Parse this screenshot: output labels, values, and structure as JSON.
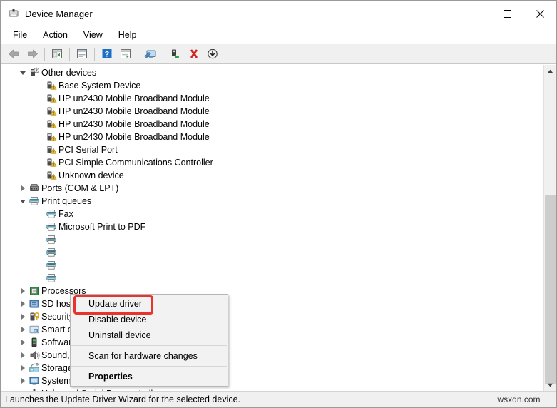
{
  "window": {
    "title": "Device Manager",
    "icon": "device-manager-icon",
    "controls": {
      "minimize": "—",
      "maximize": "☐",
      "close": "✕"
    }
  },
  "menubar": {
    "items": [
      "File",
      "Action",
      "View",
      "Help"
    ]
  },
  "toolbar": {
    "buttons": [
      {
        "name": "back-button",
        "glyph": "back-arrow-icon"
      },
      {
        "name": "forward-button",
        "glyph": "forward-arrow-icon"
      },
      {
        "sep": true
      },
      {
        "name": "show-hide-console-tree-button",
        "glyph": "console-tree-icon"
      },
      {
        "sep": true
      },
      {
        "name": "properties-button",
        "glyph": "properties-window-icon"
      },
      {
        "sep": true
      },
      {
        "name": "help-button",
        "glyph": "help-question-icon"
      },
      {
        "name": "view-button",
        "glyph": "view-list-icon"
      },
      {
        "sep": true
      },
      {
        "name": "scan-for-hardware-changes-button",
        "glyph": "scan-monitor-icon"
      },
      {
        "sep": true
      },
      {
        "name": "update-driver-button",
        "glyph": "update-driver-icon"
      },
      {
        "name": "uninstall-device-button",
        "glyph": "red-x-icon"
      },
      {
        "name": "disable-device-button",
        "glyph": "down-arrow-circle-icon"
      }
    ]
  },
  "tree": {
    "rows": [
      {
        "depth": 0,
        "twisty": "down",
        "icon": "unknown-device-icon",
        "label": "Other devices"
      },
      {
        "depth": 1,
        "twisty": "none",
        "icon": "warning-device-icon",
        "label": "Base System Device"
      },
      {
        "depth": 1,
        "twisty": "none",
        "icon": "warning-device-icon",
        "label": "HP un2430 Mobile Broadband Module"
      },
      {
        "depth": 1,
        "twisty": "none",
        "icon": "warning-device-icon",
        "label": "HP un2430 Mobile Broadband Module"
      },
      {
        "depth": 1,
        "twisty": "none",
        "icon": "warning-device-icon",
        "label": "HP un2430 Mobile Broadband Module"
      },
      {
        "depth": 1,
        "twisty": "none",
        "icon": "warning-device-icon",
        "label": "HP un2430 Mobile Broadband Module"
      },
      {
        "depth": 1,
        "twisty": "none",
        "icon": "warning-device-icon",
        "label": "PCI Serial Port"
      },
      {
        "depth": 1,
        "twisty": "none",
        "icon": "warning-device-icon",
        "label": "PCI Simple Communications Controller"
      },
      {
        "depth": 1,
        "twisty": "none",
        "icon": "warning-device-icon",
        "label": "Unknown device"
      },
      {
        "depth": 0,
        "twisty": "right",
        "icon": "ports-icon",
        "label": "Ports (COM & LPT)"
      },
      {
        "depth": 0,
        "twisty": "down",
        "icon": "printer-icon",
        "label": "Print queues"
      },
      {
        "depth": 1,
        "twisty": "none",
        "icon": "printer-icon",
        "label": "Fax"
      },
      {
        "depth": 1,
        "twisty": "none",
        "icon": "printer-icon",
        "label": "Microsoft Print to PDF"
      },
      {
        "depth": 1,
        "twisty": "none",
        "icon": "printer-icon",
        "label": "",
        "selected": true
      },
      {
        "depth": 1,
        "twisty": "none",
        "icon": "printer-icon",
        "label": ""
      },
      {
        "depth": 1,
        "twisty": "none",
        "icon": "printer-icon",
        "label": ""
      },
      {
        "depth": 1,
        "twisty": "none",
        "icon": "printer-icon",
        "label": ""
      },
      {
        "depth": 0,
        "twisty": "right",
        "icon": "processor-icon",
        "label": "Processors"
      },
      {
        "depth": 0,
        "twisty": "right",
        "icon": "sd-host-adapter-icon",
        "label": "SD host adapters"
      },
      {
        "depth": 0,
        "twisty": "right",
        "icon": "security-device-icon",
        "label": "Security devices"
      },
      {
        "depth": 0,
        "twisty": "right",
        "icon": "smart-card-reader-icon",
        "label": "Smart card readers"
      },
      {
        "depth": 0,
        "twisty": "right",
        "icon": "software-device-icon",
        "label": "Software devices"
      },
      {
        "depth": 0,
        "twisty": "right",
        "icon": "sound-icon",
        "label": "Sound, video and game controllers"
      },
      {
        "depth": 0,
        "twisty": "right",
        "icon": "storage-controller-icon",
        "label": "Storage controllers"
      },
      {
        "depth": 0,
        "twisty": "right",
        "icon": "system-device-icon",
        "label": "System devices"
      },
      {
        "depth": 0,
        "twisty": "right",
        "icon": "usb-icon",
        "label": "Universal Serial Bus controllers"
      }
    ]
  },
  "context_menu": {
    "items": [
      {
        "label": "Update driver",
        "bold": false,
        "highlighted": true
      },
      {
        "label": "Disable device",
        "bold": false
      },
      {
        "label": "Uninstall device",
        "bold": false
      },
      {
        "sep": true
      },
      {
        "label": "Scan for hardware changes",
        "bold": false
      },
      {
        "sep": true
      },
      {
        "label": "Properties",
        "bold": true
      }
    ],
    "highlight_color": "#e8342d"
  },
  "statusbar": {
    "message": "Launches the Update Driver Wizard for the selected device.",
    "watermark": "wsxdn.com"
  },
  "scrollbar": {
    "up_glyph": "▲",
    "down_glyph": "▼"
  }
}
